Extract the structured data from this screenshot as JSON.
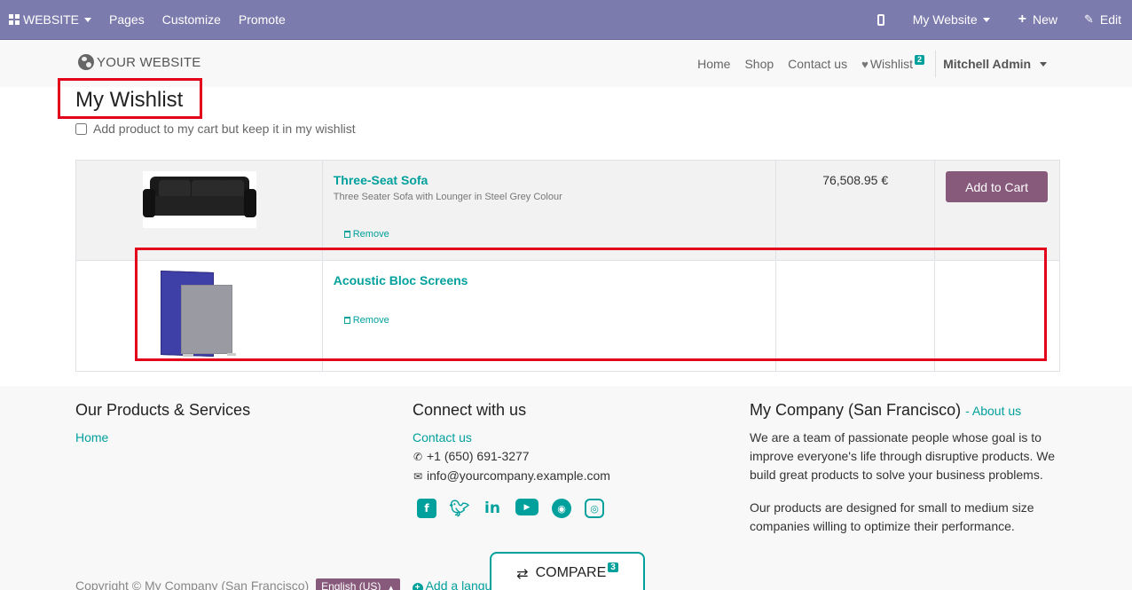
{
  "adminbar": {
    "website": "WEBSITE",
    "pages": "Pages",
    "customize": "Customize",
    "promote": "Promote",
    "my_website": "My Website",
    "new": "New",
    "edit": "Edit"
  },
  "header": {
    "logo": "YOUR WEBSITE",
    "nav": [
      "Home",
      "Shop",
      "Contact us"
    ],
    "wishlist": "Wishlist",
    "wishlist_count": "2",
    "user": "Mitchell Admin"
  },
  "page": {
    "title": "My Wishlist",
    "keep_label": "Add product to my cart but keep it in my wishlist"
  },
  "wishlist": {
    "rows": [
      {
        "name": "Three-Seat Sofa",
        "description": "Three Seater Sofa with Lounger in Steel Grey Colour",
        "price": "76,508.95 €",
        "remove": "Remove",
        "action": "Add to Cart"
      },
      {
        "name": "Acoustic Bloc Screens",
        "description": "",
        "price": "",
        "remove": "Remove",
        "action": ""
      }
    ]
  },
  "footer": {
    "col1_title": "Our Products & Services",
    "col1_link": "Home",
    "col2_title": "Connect with us",
    "contact": "Contact us",
    "phone": "+1 (650) 691-3277",
    "email": "info@yourcompany.example.com",
    "col3_title": "My Company (San Francisco)",
    "about": "About us",
    "p1": "We are a team of passionate people whose goal is to improve everyone's life through disruptive products. We build great products to solve your business problems.",
    "p2": "Our products are designed for small to medium size companies willing to optimize their performance.",
    "copyright": "Copyright © My Company (San Francisco)",
    "lang": "English (US)",
    "add_lang": "Add a language"
  },
  "compare": {
    "label": "COMPARE",
    "count": "3"
  },
  "colors": {
    "admin_bar": "#7c7bad",
    "accent": "#00a09d",
    "button": "#875a7b",
    "highlight": "#e3001b"
  }
}
